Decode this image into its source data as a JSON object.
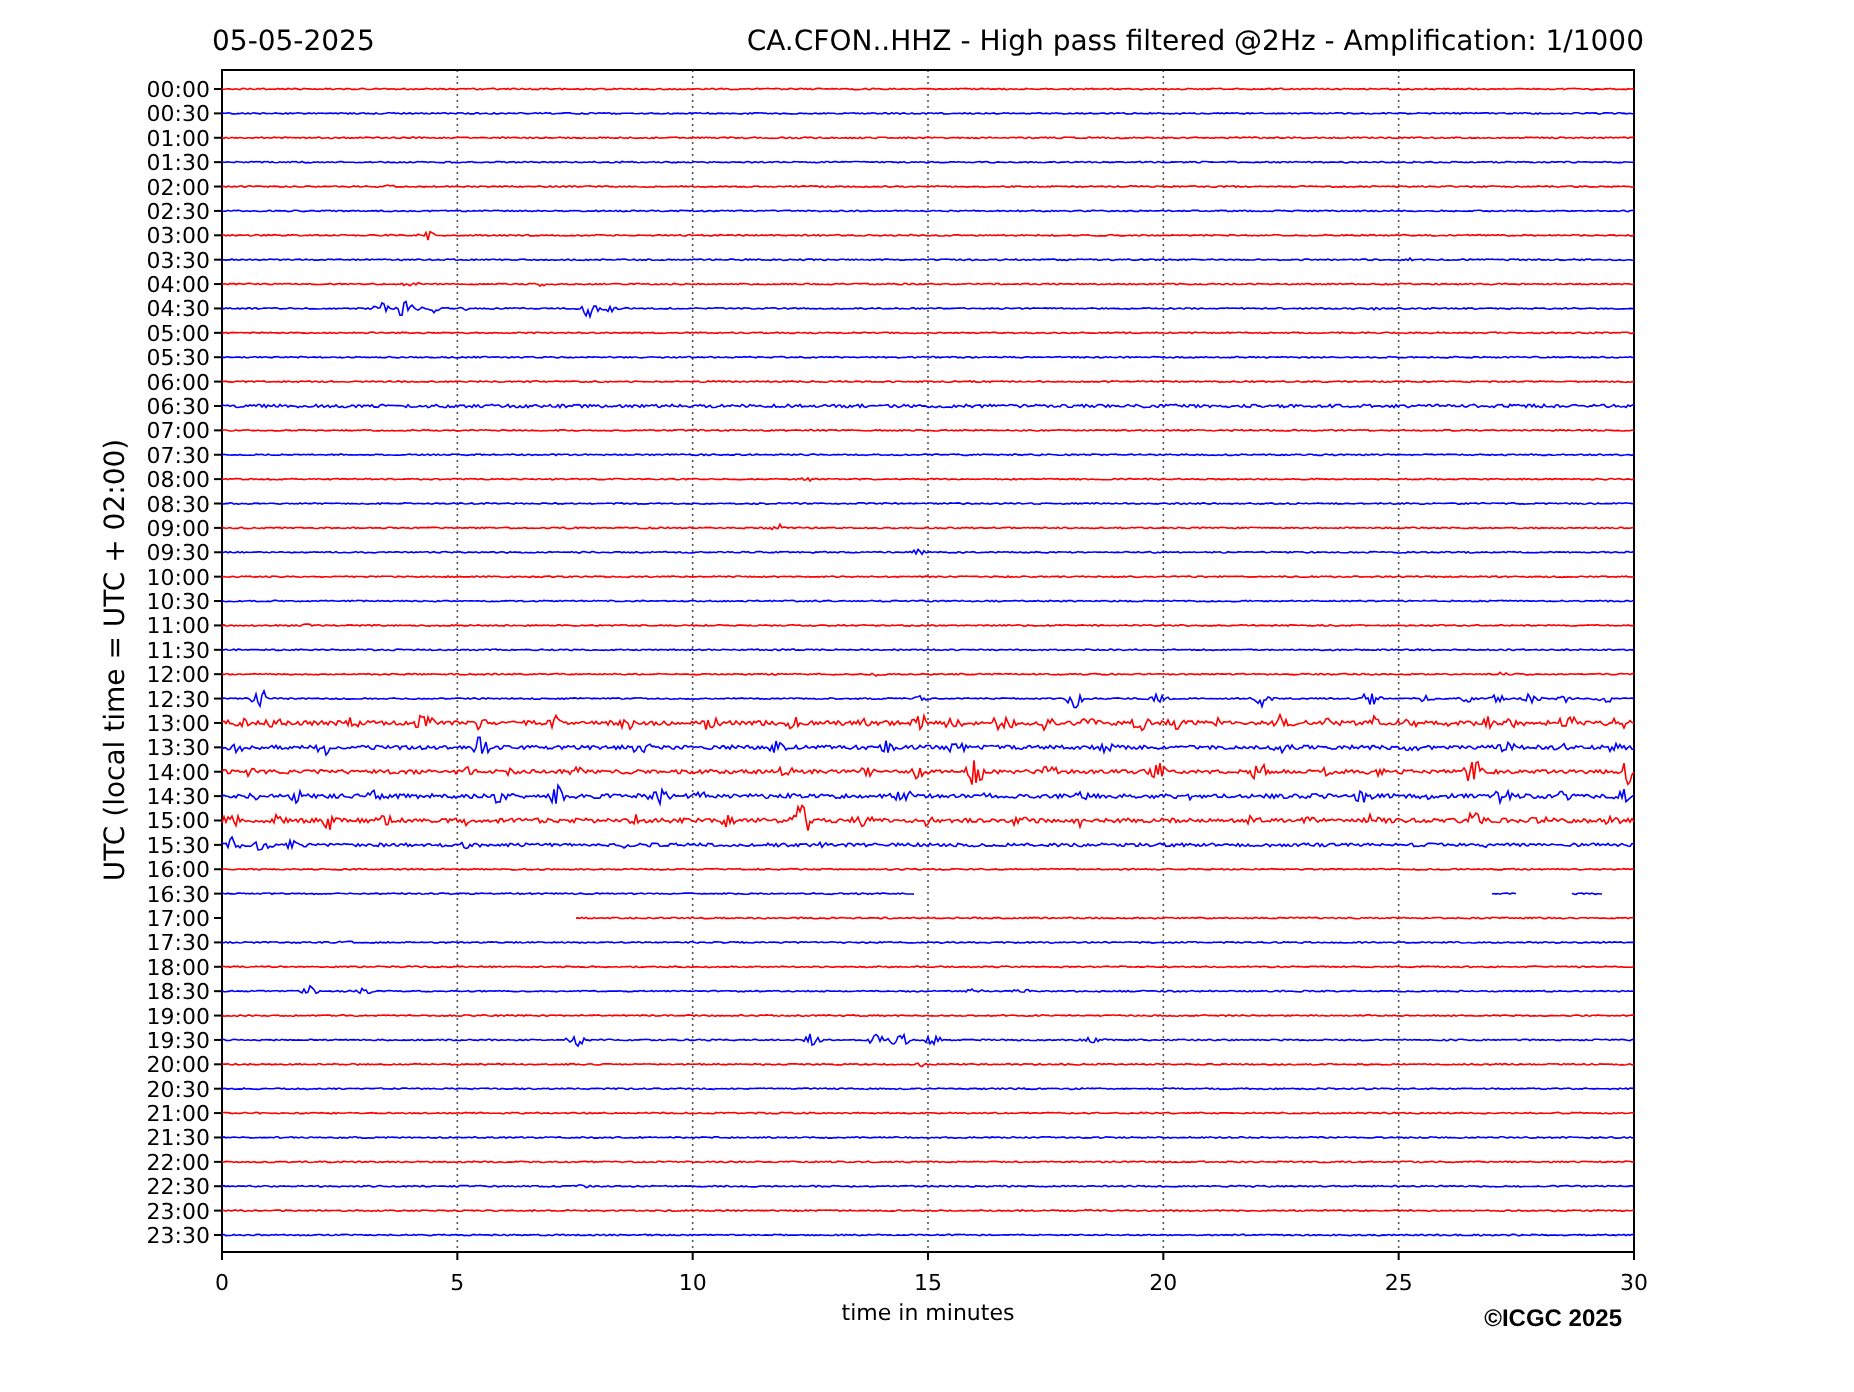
{
  "title_left": "05-05-2025",
  "title_right": "CA.CFON..HHZ - High pass filtered @2Hz - Amplification: 1/1000",
  "y_axis_label": "UTC (local time = UTC + 02:00)",
  "rows": [
    {
      "label": "00:00",
      "color": "#ff0000"
    },
    {
      "label": "00:30",
      "color": "#0000ff"
    },
    {
      "label": "01:00",
      "color": "#ff0000"
    },
    {
      "label": "01:30",
      "color": "#0000ff"
    },
    {
      "label": "02:00",
      "color": "#ff0000"
    },
    {
      "label": "02:30",
      "color": "#0000ff"
    },
    {
      "label": "03:00",
      "color": "#ff0000"
    },
    {
      "label": "03:30",
      "color": "#0000ff"
    },
    {
      "label": "04:00",
      "color": "#ff0000"
    },
    {
      "label": "04:30",
      "color": "#0000ff"
    },
    {
      "label": "05:00",
      "color": "#ff0000"
    },
    {
      "label": "05:30",
      "color": "#0000ff"
    },
    {
      "label": "06:00",
      "color": "#ff0000"
    },
    {
      "label": "06:30",
      "color": "#0000ff"
    },
    {
      "label": "07:00",
      "color": "#ff0000"
    },
    {
      "label": "07:30",
      "color": "#0000ff"
    },
    {
      "label": "08:00",
      "color": "#ff0000"
    },
    {
      "label": "08:30",
      "color": "#0000ff"
    },
    {
      "label": "09:00",
      "color": "#ff0000"
    },
    {
      "label": "09:30",
      "color": "#0000ff"
    },
    {
      "label": "10:00",
      "color": "#ff0000"
    },
    {
      "label": "10:30",
      "color": "#0000ff"
    },
    {
      "label": "11:00",
      "color": "#ff0000"
    },
    {
      "label": "11:30",
      "color": "#0000ff"
    },
    {
      "label": "12:00",
      "color": "#ff0000"
    },
    {
      "label": "12:30",
      "color": "#0000ff"
    },
    {
      "label": "13:00",
      "color": "#ff0000"
    },
    {
      "label": "13:30",
      "color": "#0000ff"
    },
    {
      "label": "14:00",
      "color": "#ff0000"
    },
    {
      "label": "14:30",
      "color": "#0000ff"
    },
    {
      "label": "15:00",
      "color": "#ff0000"
    },
    {
      "label": "15:30",
      "color": "#0000ff"
    },
    {
      "label": "16:00",
      "color": "#ff0000"
    },
    {
      "label": "16:30",
      "color": "#0000ff"
    },
    {
      "label": "17:00",
      "color": "#ff0000"
    },
    {
      "label": "17:30",
      "color": "#0000ff"
    },
    {
      "label": "18:00",
      "color": "#ff0000"
    },
    {
      "label": "18:30",
      "color": "#0000ff"
    },
    {
      "label": "19:00",
      "color": "#ff0000"
    },
    {
      "label": "19:30",
      "color": "#0000ff"
    },
    {
      "label": "20:00",
      "color": "#ff0000"
    },
    {
      "label": "20:30",
      "color": "#0000ff"
    },
    {
      "label": "21:00",
      "color": "#ff0000"
    },
    {
      "label": "21:30",
      "color": "#0000ff"
    },
    {
      "label": "22:00",
      "color": "#ff0000"
    },
    {
      "label": "22:30",
      "color": "#0000ff"
    },
    {
      "label": "23:00",
      "color": "#ff0000"
    },
    {
      "label": "23:30",
      "color": "#0000ff"
    }
  ],
  "x_ticks": [
    "0",
    "5",
    "10",
    "15",
    "20",
    "25",
    "30"
  ],
  "x_axis_label": "time in minutes",
  "copyright": "©ICGC 2025"
}
